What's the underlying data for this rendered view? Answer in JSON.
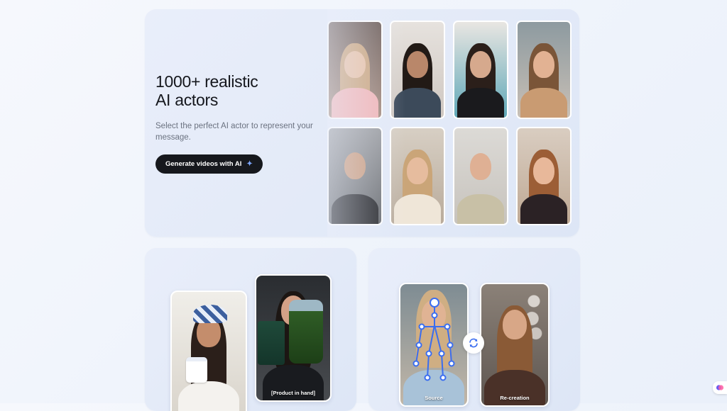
{
  "hero": {
    "title_line1": "1000+ realistic",
    "title_line2": "AI actors",
    "description": "Select the perfect AI actor to represent your message.",
    "cta_label": "Generate videos with AI",
    "cta_icon": "sparkle-icon"
  },
  "actor_grid": [
    {
      "name": "actor-woman-glasses"
    },
    {
      "name": "actor-woman-dark-hair"
    },
    {
      "name": "actor-woman-black-top"
    },
    {
      "name": "actor-woman-car"
    },
    {
      "name": "actor-man-gym"
    },
    {
      "name": "actor-woman-blonde"
    },
    {
      "name": "actor-man-beige-shirt"
    },
    {
      "name": "actor-woman-auburn"
    }
  ],
  "product_card": {
    "caption": "[Product in hand]"
  },
  "recreation_card": {
    "source_label": "Source",
    "recreation_label": "Re-creation",
    "swap_icon": "refresh-icon"
  },
  "chat_widget": {
    "icon": "chat-widget-icon"
  },
  "colors": {
    "background": "#f3f6fc",
    "card": "#e6ecf9",
    "cta_bg": "#16181d",
    "accent_blue": "#3a6df0"
  }
}
